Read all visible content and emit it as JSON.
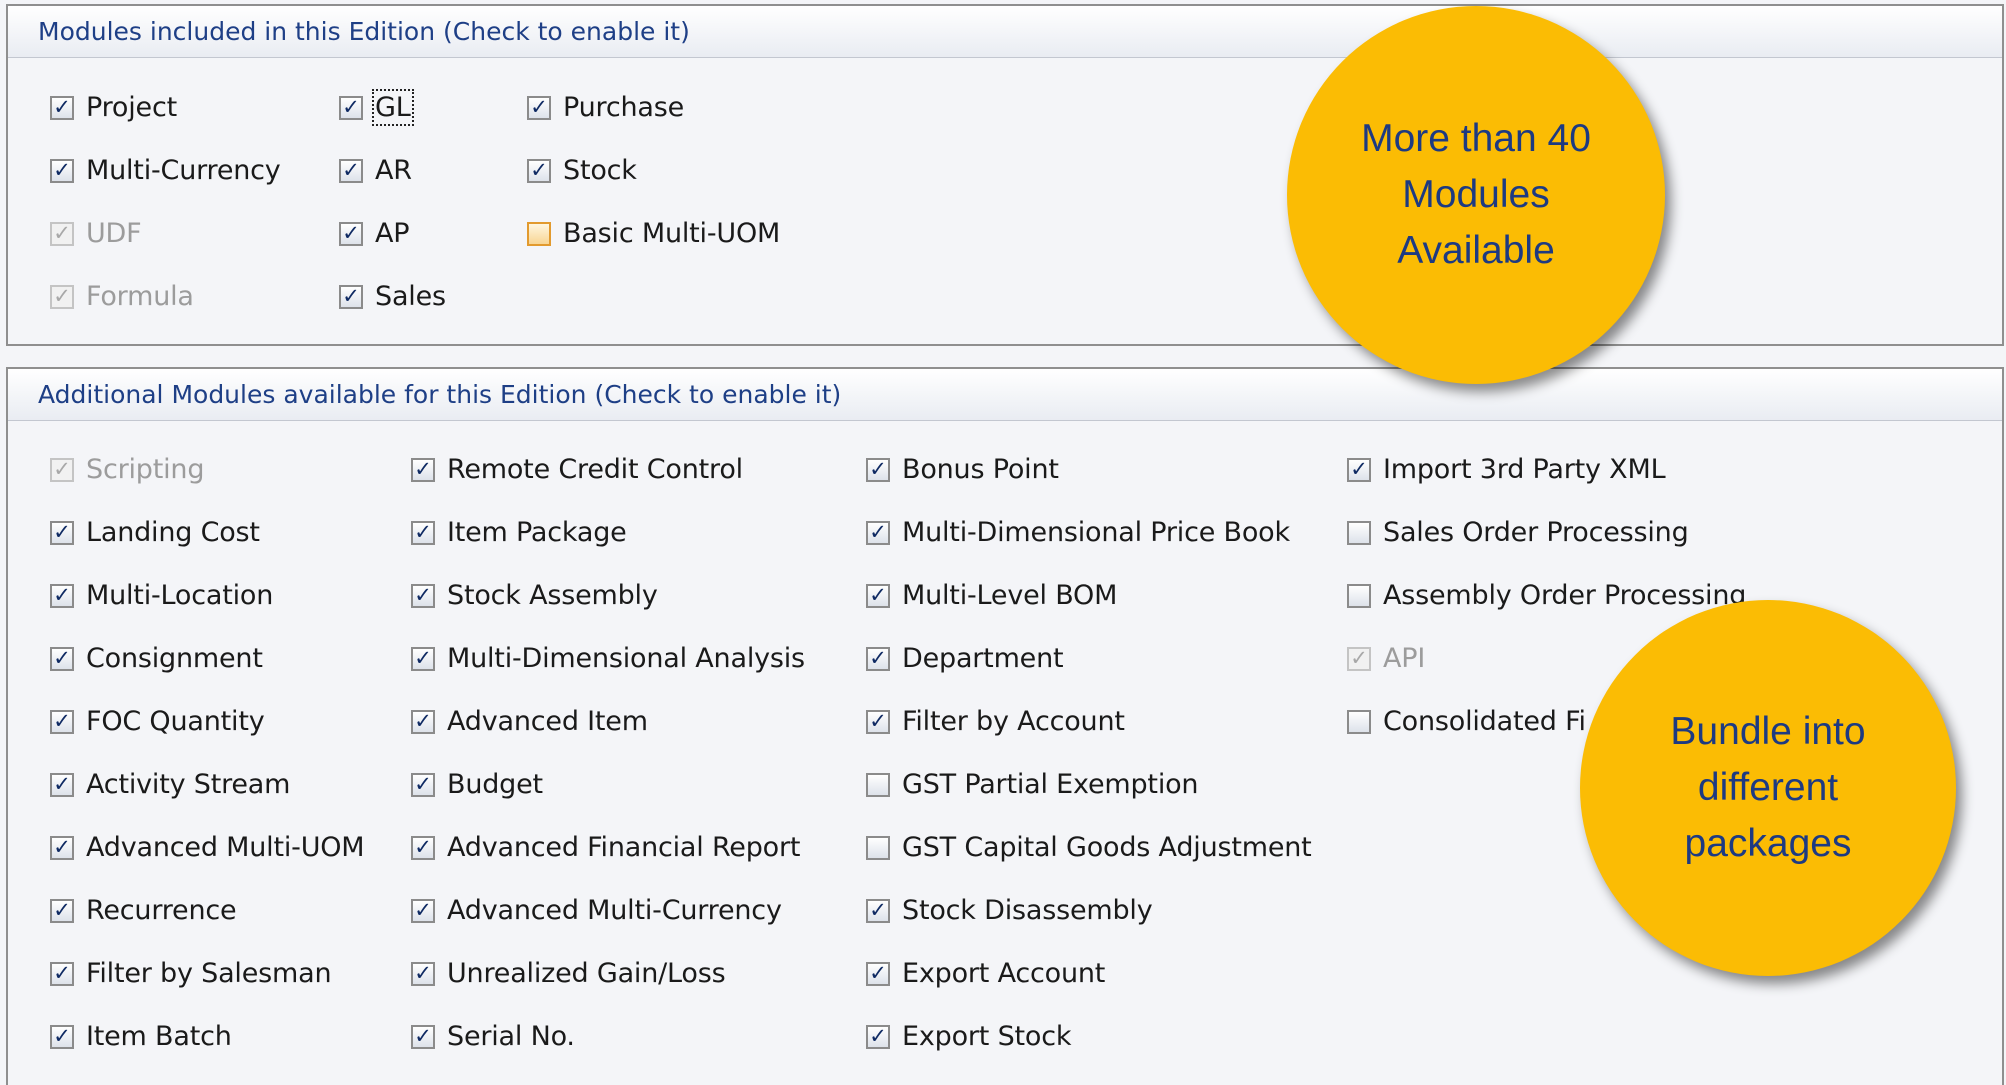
{
  "edition_group": {
    "title": "Modules included in this Edition (Check to enable it)",
    "items": [
      {
        "label": "Project",
        "checked": true,
        "disabled": false
      },
      {
        "label": "Multi-Currency",
        "checked": true,
        "disabled": false
      },
      {
        "label": "UDF",
        "checked": true,
        "disabled": true
      },
      {
        "label": "Formula",
        "checked": true,
        "disabled": true
      },
      {
        "label": "GL",
        "checked": true,
        "disabled": false
      },
      {
        "label": "AR",
        "checked": true,
        "disabled": false
      },
      {
        "label": "AP",
        "checked": true,
        "disabled": false
      },
      {
        "label": "Sales",
        "checked": true,
        "disabled": false
      },
      {
        "label": "Purchase",
        "checked": true,
        "disabled": false
      },
      {
        "label": "Stock",
        "checked": true,
        "disabled": false
      },
      {
        "label": "Basic Multi-UOM",
        "checked": false,
        "disabled": false
      }
    ]
  },
  "additional_group": {
    "title": "Additional Modules available for this Edition (Check to enable it)",
    "items": [
      {
        "label": "Scripting",
        "checked": true,
        "disabled": true
      },
      {
        "label": "Landing Cost",
        "checked": true,
        "disabled": false
      },
      {
        "label": "Multi-Location",
        "checked": true,
        "disabled": false
      },
      {
        "label": "Consignment",
        "checked": true,
        "disabled": false
      },
      {
        "label": "FOC Quantity",
        "checked": true,
        "disabled": false
      },
      {
        "label": "Activity Stream",
        "checked": true,
        "disabled": false
      },
      {
        "label": "Advanced Multi-UOM",
        "checked": true,
        "disabled": false
      },
      {
        "label": "Recurrence",
        "checked": true,
        "disabled": false
      },
      {
        "label": "Filter by Salesman",
        "checked": true,
        "disabled": false
      },
      {
        "label": "Item Batch",
        "checked": true,
        "disabled": false
      },
      {
        "label": "Remote Credit Control",
        "checked": true,
        "disabled": false
      },
      {
        "label": "Item Package",
        "checked": true,
        "disabled": false
      },
      {
        "label": "Stock Assembly",
        "checked": true,
        "disabled": false
      },
      {
        "label": "Multi-Dimensional Analysis",
        "checked": true,
        "disabled": false
      },
      {
        "label": "Advanced Item",
        "checked": true,
        "disabled": false
      },
      {
        "label": "Budget",
        "checked": true,
        "disabled": false
      },
      {
        "label": "Advanced Financial Report",
        "checked": true,
        "disabled": false
      },
      {
        "label": "Advanced Multi-Currency",
        "checked": true,
        "disabled": false
      },
      {
        "label": "Unrealized Gain/Loss",
        "checked": true,
        "disabled": false
      },
      {
        "label": "Serial No.",
        "checked": true,
        "disabled": false
      },
      {
        "label": "Bonus Point",
        "checked": true,
        "disabled": false
      },
      {
        "label": "Multi-Dimensional Price Book",
        "checked": true,
        "disabled": false
      },
      {
        "label": "Multi-Level BOM",
        "checked": true,
        "disabled": false
      },
      {
        "label": "Department",
        "checked": true,
        "disabled": false
      },
      {
        "label": "Filter by Account",
        "checked": true,
        "disabled": false
      },
      {
        "label": "GST Partial Exemption",
        "checked": false,
        "disabled": false
      },
      {
        "label": "GST Capital Goods Adjustment",
        "checked": false,
        "disabled": false
      },
      {
        "label": "Stock Disassembly",
        "checked": true,
        "disabled": false
      },
      {
        "label": "Export Account",
        "checked": true,
        "disabled": false
      },
      {
        "label": "Export Stock",
        "checked": true,
        "disabled": false
      },
      {
        "label": "Import 3rd Party XML",
        "checked": true,
        "disabled": false
      },
      {
        "label": "Sales Order Processing",
        "checked": false,
        "disabled": false
      },
      {
        "label": "Assembly Order Processing",
        "checked": false,
        "disabled": false
      },
      {
        "label": "API",
        "checked": true,
        "disabled": true
      },
      {
        "label": "Consolidated Fi",
        "checked": false,
        "disabled": false
      }
    ]
  },
  "callouts": {
    "modules": "More than 40\nModules\nAvailable",
    "bundle": "Bundle into\ndifferent\npackages"
  },
  "colors": {
    "callout_fill": "#fbbc04",
    "callout_text": "#1d3a82",
    "header_text": "#1e3f86"
  }
}
